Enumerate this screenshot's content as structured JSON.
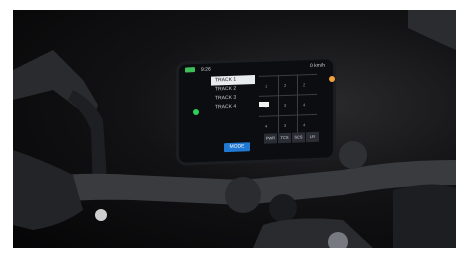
{
  "dash": {
    "time": "9:26",
    "status_right": "0 km/h",
    "tracks": [
      "TRACK 1",
      "TRACK 2",
      "TRACK 3",
      "TRACK 4"
    ],
    "selected_track_index": 0,
    "mode_label": "MODE",
    "tabs": [
      "PWR",
      "TCS",
      "SCS",
      "LR"
    ],
    "grid_values": [
      "1",
      "2",
      "2",
      "3",
      "3",
      "4",
      "4",
      "3",
      "4"
    ]
  },
  "colors": {
    "mode_button": "#1f78d1",
    "indicator_green": "#2bd35b",
    "indicator_orange": "#f2a23a"
  }
}
